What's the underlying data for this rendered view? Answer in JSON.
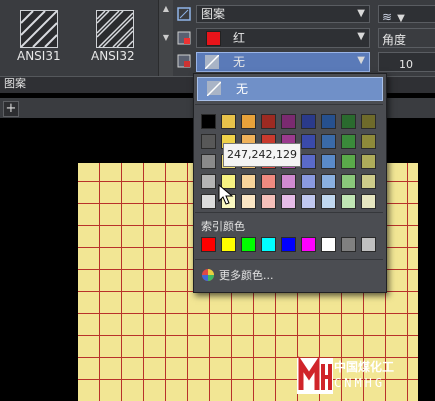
{
  "ribbon": {
    "patterns": [
      {
        "name": "ANSI31",
        "icon": "hatch-ansi31-icon"
      },
      {
        "name": "ANSI32",
        "icon": "hatch-ansi32-icon"
      }
    ],
    "pattern_type_combo": {
      "value": "图案"
    },
    "color_combo": {
      "value": "红",
      "swatch": "#e8141a"
    },
    "background_combo": {
      "value": "无"
    },
    "angle_label": "角度",
    "scale_value": "10",
    "panel_title": "图案"
  },
  "dropdown": {
    "none_label": "无",
    "true_colors": [
      [
        "#000000",
        "#e8c24a",
        "#e8a23a",
        "#9c2a22",
        "#7a2a70",
        "#2a3a8a",
        "#26508e",
        "#2a6a2e",
        "#6e6a2a"
      ],
      [
        "#585858",
        "#f0d24a",
        "#f0b25a",
        "#c83a2e",
        "#9a3a8e",
        "#3a4aaa",
        "#3a6aa8",
        "#3a8a3a",
        "#8e8a3a"
      ],
      [
        "#8a8a8a",
        "#f4e07a",
        "#f4c47a",
        "#e0524a",
        "#b85ab0",
        "#5a6ac8",
        "#5a8ac8",
        "#5aaa4a",
        "#aeac5a"
      ],
      [
        "#b4b4b4",
        "#f7f282",
        "#f8d49a",
        "#f08a80",
        "#d08ad0",
        "#8a9ae0",
        "#8ab0e0",
        "#8ac87a",
        "#cecc8a"
      ],
      [
        "#dcdcdc",
        "#faf8c0",
        "#fbe6c4",
        "#f6c0ba",
        "#e6bce8",
        "#c0c8f0",
        "#c0d8f0",
        "#c0e6b4",
        "#e6e6c0"
      ]
    ],
    "index_label": "索引颜色",
    "index_colors": [
      "#ff0000",
      "#ffff00",
      "#00ff00",
      "#00ffff",
      "#0000ff",
      "#ff00ff",
      "#ffffff",
      "#808080",
      "#c0c0c0"
    ],
    "more_colors_label": "更多颜色...",
    "tooltip": "247,242,129"
  },
  "watermark": {
    "line1": "中国煤化工",
    "line2": "CNMHG"
  }
}
